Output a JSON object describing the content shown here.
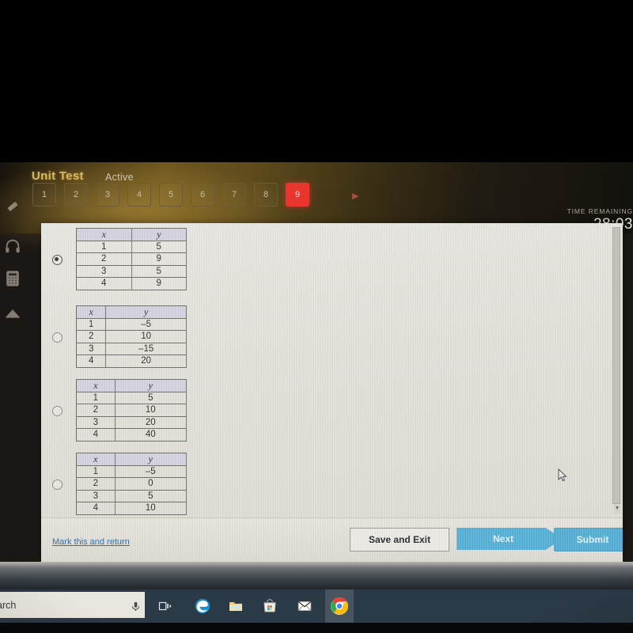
{
  "assessment": {
    "title": "Unit Test",
    "status": "Active",
    "question_tabs": [
      "1",
      "2",
      "3",
      "4",
      "5",
      "6",
      "7",
      "8",
      "9"
    ],
    "selected_tab": "9",
    "next_tab_arrow": "▶"
  },
  "timer": {
    "label": "TIME REMAINING",
    "value": "28:03"
  },
  "tool_rail": [
    {
      "name": "eraser-icon"
    },
    {
      "name": "headphones-icon"
    },
    {
      "name": "calculator-icon"
    },
    {
      "name": "up-arrow-icon"
    }
  ],
  "options": [
    {
      "id": "option-a",
      "selected": true,
      "headers": [
        "x",
        "y"
      ],
      "rows": [
        [
          "1",
          "5"
        ],
        [
          "2",
          "9"
        ],
        [
          "3",
          "5"
        ],
        [
          "4",
          "9"
        ]
      ]
    },
    {
      "id": "option-b",
      "selected": false,
      "headers": [
        "x",
        "y"
      ],
      "rows": [
        [
          "1",
          "–5"
        ],
        [
          "2",
          "10"
        ],
        [
          "3",
          "–15"
        ],
        [
          "4",
          "20"
        ]
      ]
    },
    {
      "id": "option-c",
      "selected": false,
      "headers": [
        "x",
        "y"
      ],
      "rows": [
        [
          "1",
          "5"
        ],
        [
          "2",
          "10"
        ],
        [
          "3",
          "20"
        ],
        [
          "4",
          "40"
        ]
      ]
    },
    {
      "id": "option-d",
      "selected": false,
      "headers": [
        "x",
        "y"
      ],
      "rows": [
        [
          "1",
          "–5"
        ],
        [
          "2",
          "0"
        ],
        [
          "3",
          "5"
        ],
        [
          "4",
          "10"
        ]
      ]
    }
  ],
  "footer": {
    "mark_link": "Mark this and return",
    "save_exit": "Save and Exit",
    "next": "Next",
    "submit": "Submit"
  },
  "taskbar": {
    "search_text": "arch",
    "icons": [
      "microphone-icon",
      "task-view-icon",
      "edge-icon",
      "file-explorer-icon",
      "microsoft-store-icon",
      "mail-icon",
      "chrome-icon"
    ]
  },
  "colors": {
    "accent_red": "#e8362f",
    "accent_blue": "#56b0d6",
    "title_gold": "#d9b860",
    "link_blue": "#2f6b9e"
  },
  "scrollbar": {
    "arrow": "▼"
  }
}
